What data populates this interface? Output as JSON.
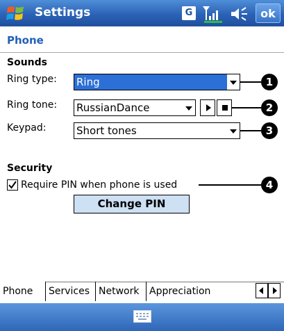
{
  "titlebar": {
    "title": "Settings",
    "g_icon": "G",
    "ok_label": "ok",
    "icons": [
      "windows-start-icon",
      "g-icon",
      "signal-icon",
      "volume-icon"
    ]
  },
  "page": {
    "title": "Phone"
  },
  "sounds": {
    "heading": "Sounds",
    "ring_type": {
      "label": "Ring type:",
      "value": "Ring"
    },
    "ring_tone": {
      "label": "Ring tone:",
      "value": "RussianDance"
    },
    "keypad": {
      "label": "Keypad:",
      "value": "Short tones"
    }
  },
  "security": {
    "heading": "Security",
    "require_pin_label": "Require PIN when phone is used",
    "require_pin_checked": true,
    "change_pin_label": "Change PIN"
  },
  "callouts": [
    "1",
    "2",
    "3",
    "4"
  ],
  "tabs": [
    {
      "label": "Phone",
      "active": true
    },
    {
      "label": "Services",
      "active": false
    },
    {
      "label": "Network",
      "active": false
    },
    {
      "label": "Appreciation",
      "active": false
    }
  ],
  "colors": {
    "accent": "#2160b8",
    "selection": "#2c6fd6",
    "button_fill": "#cde0f4"
  }
}
